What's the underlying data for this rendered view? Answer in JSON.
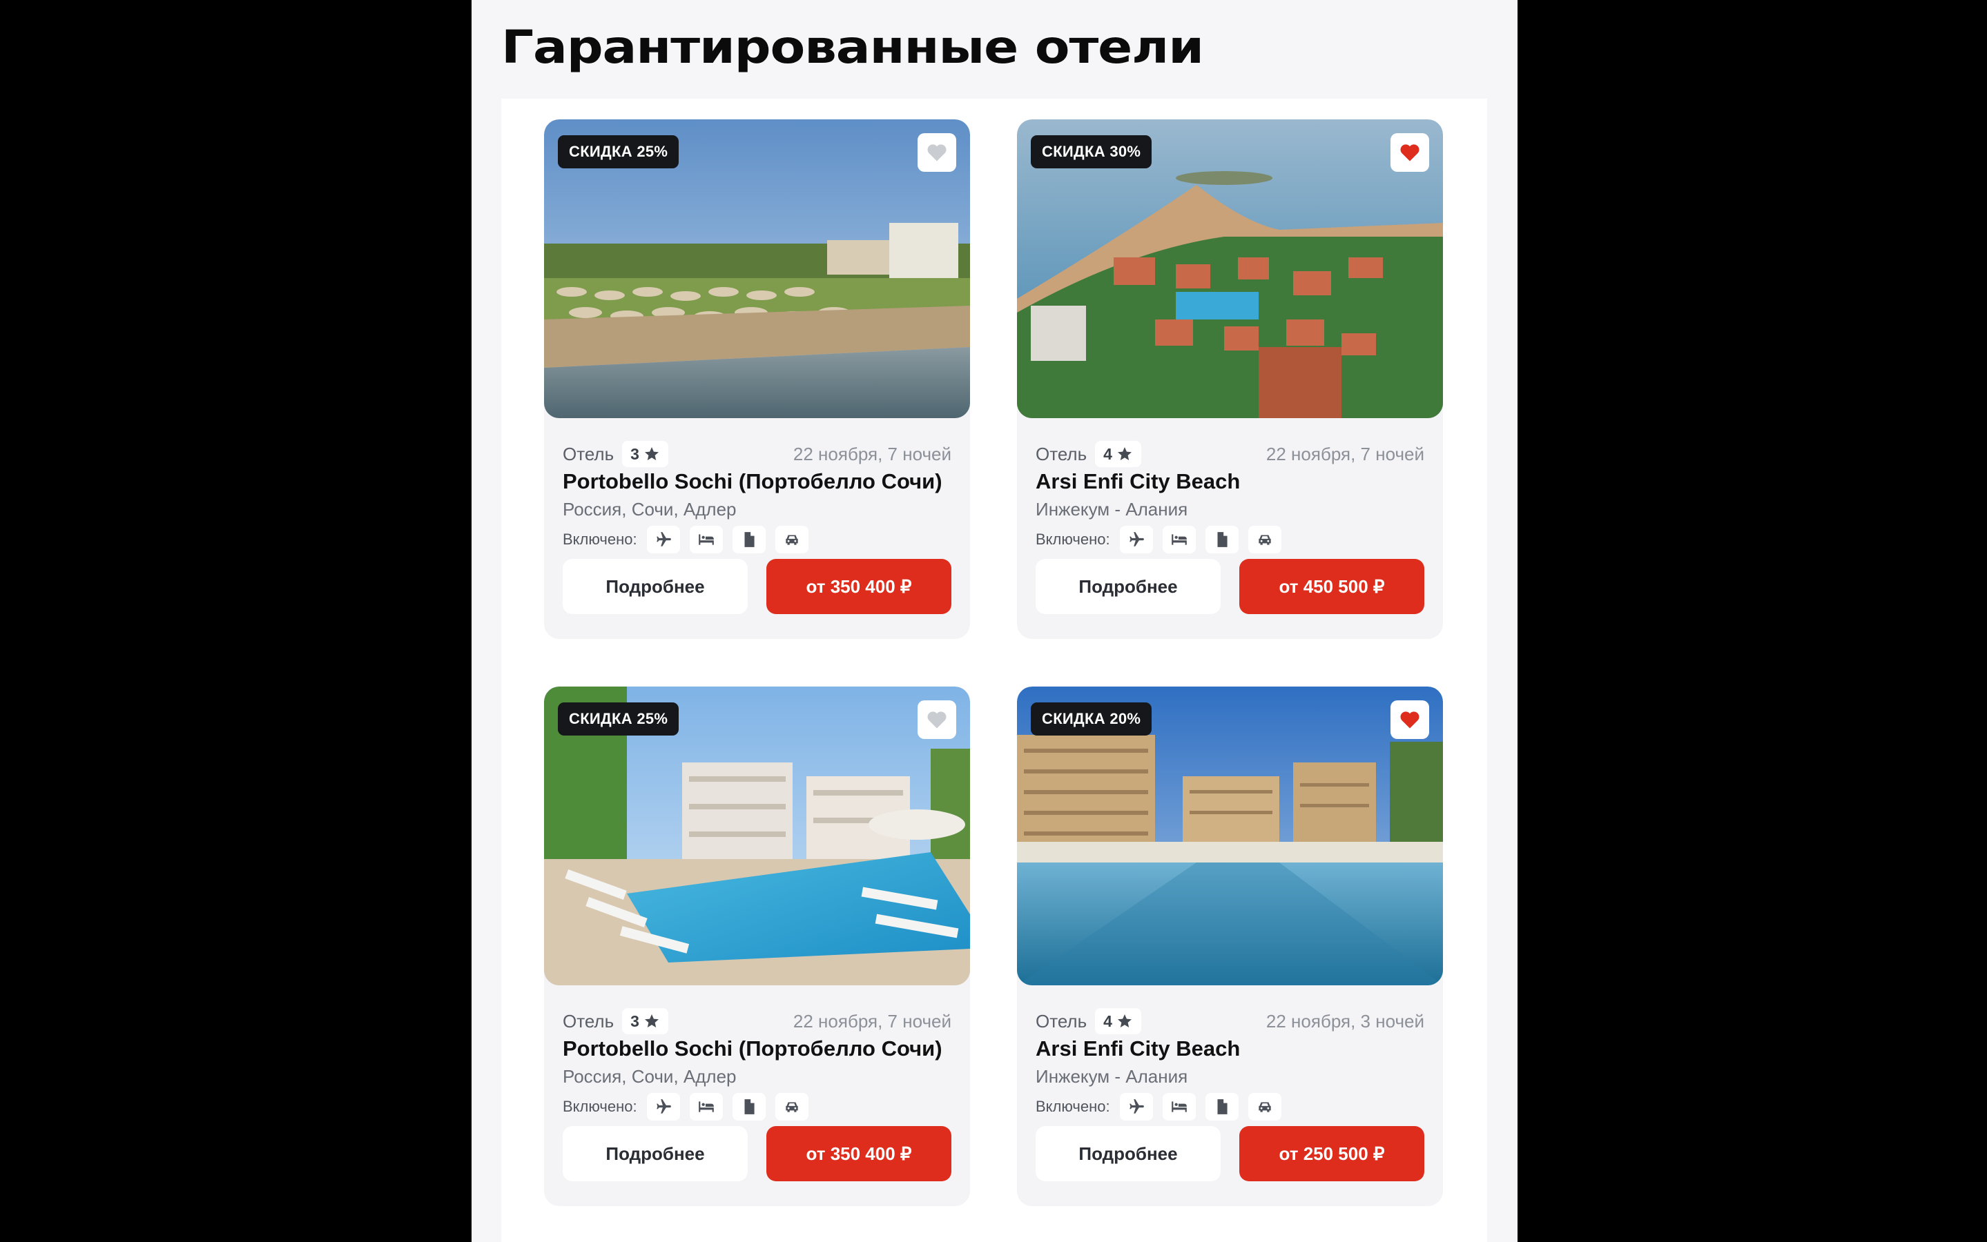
{
  "section": {
    "title": "Гарантированные отели"
  },
  "labels": {
    "kind": "Отель",
    "included": "Включено:",
    "more_button": "Подробнее"
  },
  "colors": {
    "accent": "#de2d1c",
    "badge": "#16171b",
    "favorite_active": "#de2d1c",
    "favorite_inactive": "#c9ccd1"
  },
  "cards": [
    {
      "badge": "СКИДКА 25%",
      "favorite": false,
      "stars": "3",
      "date": "22 ноября, 7 ночей",
      "name": "Portobello Sochi (Портобелло Сочи)",
      "location": "Россия, Сочи, Адлер",
      "price": "от 350 400 ₽",
      "photo": "beach-umbrellas"
    },
    {
      "badge": "СКИДКА 30%",
      "favorite": true,
      "stars": "4",
      "date": "22 ноября, 7 ночей",
      "name": "Arsi Enfi City Beach",
      "location": "Инжекум - Алания",
      "price": "от 450 500 ₽",
      "photo": "aerial-resort"
    },
    {
      "badge": "СКИДКА 25%",
      "favorite": false,
      "stars": "3",
      "date": "22 ноября, 7 ночей",
      "name": "Portobello Sochi (Портобелло Сочи)",
      "location": "Россия, Сочи, Адлер",
      "price": "от 350 400 ₽",
      "photo": "pool-loungers"
    },
    {
      "badge": "СКИДКА 20%",
      "favorite": true,
      "stars": "4",
      "date": "22 ноября, 3 ночей",
      "name": "Arsi Enfi City Beach",
      "location": "Инжекум - Алания",
      "price": "от 250 500 ₽",
      "photo": "resort-pool"
    }
  ],
  "included_icons": [
    "plane-icon",
    "bed-icon",
    "document-icon",
    "car-icon"
  ]
}
